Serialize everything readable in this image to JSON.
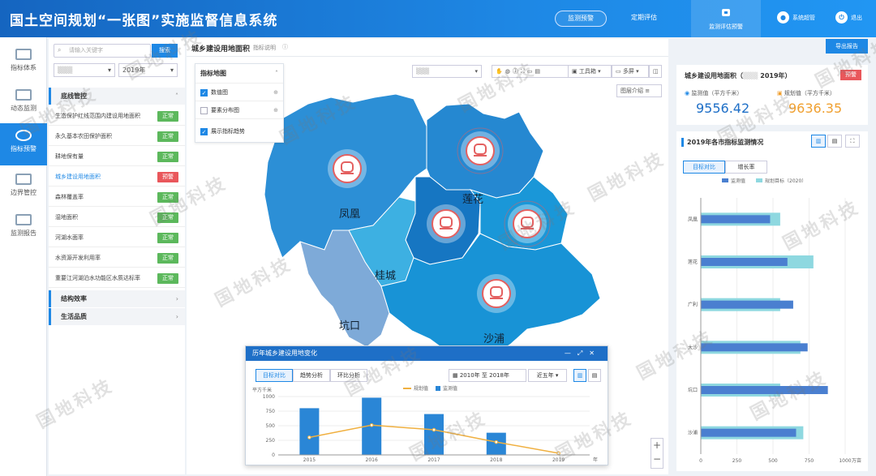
{
  "header": {
    "title": "国土空间规划“一张图”实施监督信息系统",
    "nav_monitor_alert": "监测预警",
    "nav_periodic_eval": "定期评估",
    "nav_eval_alert": "监测评估预警",
    "user": "系统超管",
    "exit": "退出"
  },
  "sidebar": {
    "items": [
      {
        "label": "指标体系"
      },
      {
        "label": "动态监测"
      },
      {
        "label": "指标预警"
      },
      {
        "label": "边界管控"
      },
      {
        "label": "监测报告"
      }
    ]
  },
  "left_panel": {
    "search_placeholder": "请输入关键字",
    "search_button": "搜索",
    "year": "2019年",
    "groups": [
      {
        "label": "底线管控"
      },
      {
        "label": "结构效率"
      },
      {
        "label": "生活品质"
      }
    ],
    "indicators": [
      {
        "label": "生态保护红线范围内建设用地面积",
        "status": "正常",
        "color": "#5cb85c"
      },
      {
        "label": "永久基本农田保护面积",
        "status": "正常",
        "color": "#5cb85c"
      },
      {
        "label": "耕地保有量",
        "status": "正常",
        "color": "#5cb85c"
      },
      {
        "label": "城乡建设用地面积",
        "status": "预警",
        "color": "#e9575b"
      },
      {
        "label": "森林覆盖率",
        "status": "正常",
        "color": "#5cb85c"
      },
      {
        "label": "湿地面积",
        "status": "正常",
        "color": "#5cb85c"
      },
      {
        "label": "河湖水面率",
        "status": "正常",
        "color": "#5cb85c"
      },
      {
        "label": "水资源开发利用率",
        "status": "正常",
        "color": "#5cb85c"
      },
      {
        "label": "重要江河湖泊水功能区水质达标率",
        "status": "正常",
        "color": "#5cb85c"
      }
    ]
  },
  "main": {
    "title": "城乡建设用地面积",
    "subtitle": "指标说明",
    "legend_title": "指标地图",
    "layers": [
      {
        "label": "数值图",
        "checked": true
      },
      {
        "label": "要素分布图",
        "checked": false
      }
    ],
    "show_trend": "展示指标趋势",
    "toolbox": "工具箱",
    "multiscreen": "多屏",
    "layer_intro": "图层介绍",
    "export": "导出报告",
    "regions": [
      {
        "name": "凤凰"
      },
      {
        "name": "莲花"
      },
      {
        "name": "桂城"
      },
      {
        "name": "坑口"
      },
      {
        "name": "沙浦"
      }
    ]
  },
  "popup": {
    "title": "历年城乡建设用地变化",
    "tabs": [
      "目标对比",
      "趋势分析",
      "环比分析"
    ],
    "year_from": "2010年",
    "to": "至",
    "year_to": "2018年",
    "range": "近五年"
  },
  "right_panel": {
    "kpi_title": "城乡建设用地面积（",
    "kpi_year": "2019年）",
    "alert": "预警",
    "monitor_label": "监测值（平方千米）",
    "monitor_value": "9556.42",
    "plan_label": "规划值（平方千米）",
    "plan_value": "9636.35",
    "chart_title": "2019年各市指标监测情况",
    "tabs": [
      "目标对比",
      "增长率"
    ]
  },
  "colors": {
    "primary": "#1e88e5",
    "alert": "#e9575b",
    "ok": "#5cb85c",
    "plan": "#f0a030"
  },
  "watermark": "国地科技",
  "chart_data": [
    {
      "type": "bar",
      "title": "历年城乡建设用地变化",
      "ylabel": "平方千米",
      "x": [
        "2015",
        "2016",
        "2017",
        "2018",
        "2019"
      ],
      "ylim": [
        0,
        1000
      ],
      "yticks": [
        0,
        250,
        500,
        750,
        1000
      ],
      "series": [
        {
          "name": "监测值",
          "type": "bar",
          "values": [
            800,
            980,
            700,
            380,
            null
          ],
          "color": "#2a86d6"
        },
        {
          "name": "规划值",
          "type": "line",
          "values": [
            300,
            510,
            430,
            220,
            30
          ],
          "color": "#f0b040"
        }
      ],
      "x_unit": "年"
    },
    {
      "type": "bar",
      "title": "2019年各市指标监测情况",
      "orientation": "horizontal",
      "categories": [
        "凤凰",
        "莲花",
        "广利",
        "大沙",
        "坑口",
        "沙浦"
      ],
      "xlim": [
        0,
        1000
      ],
      "xticks": [
        0,
        250,
        500,
        750,
        1000
      ],
      "x_unit": "万亩",
      "series": [
        {
          "name": "监测值",
          "values": [
            480,
            600,
            640,
            740,
            880,
            660
          ],
          "color": "#4a7fd0"
        },
        {
          "name": "规划目标（2020）",
          "values": [
            550,
            780,
            550,
            690,
            550,
            710
          ],
          "color": "#8ed8e0"
        }
      ]
    }
  ]
}
